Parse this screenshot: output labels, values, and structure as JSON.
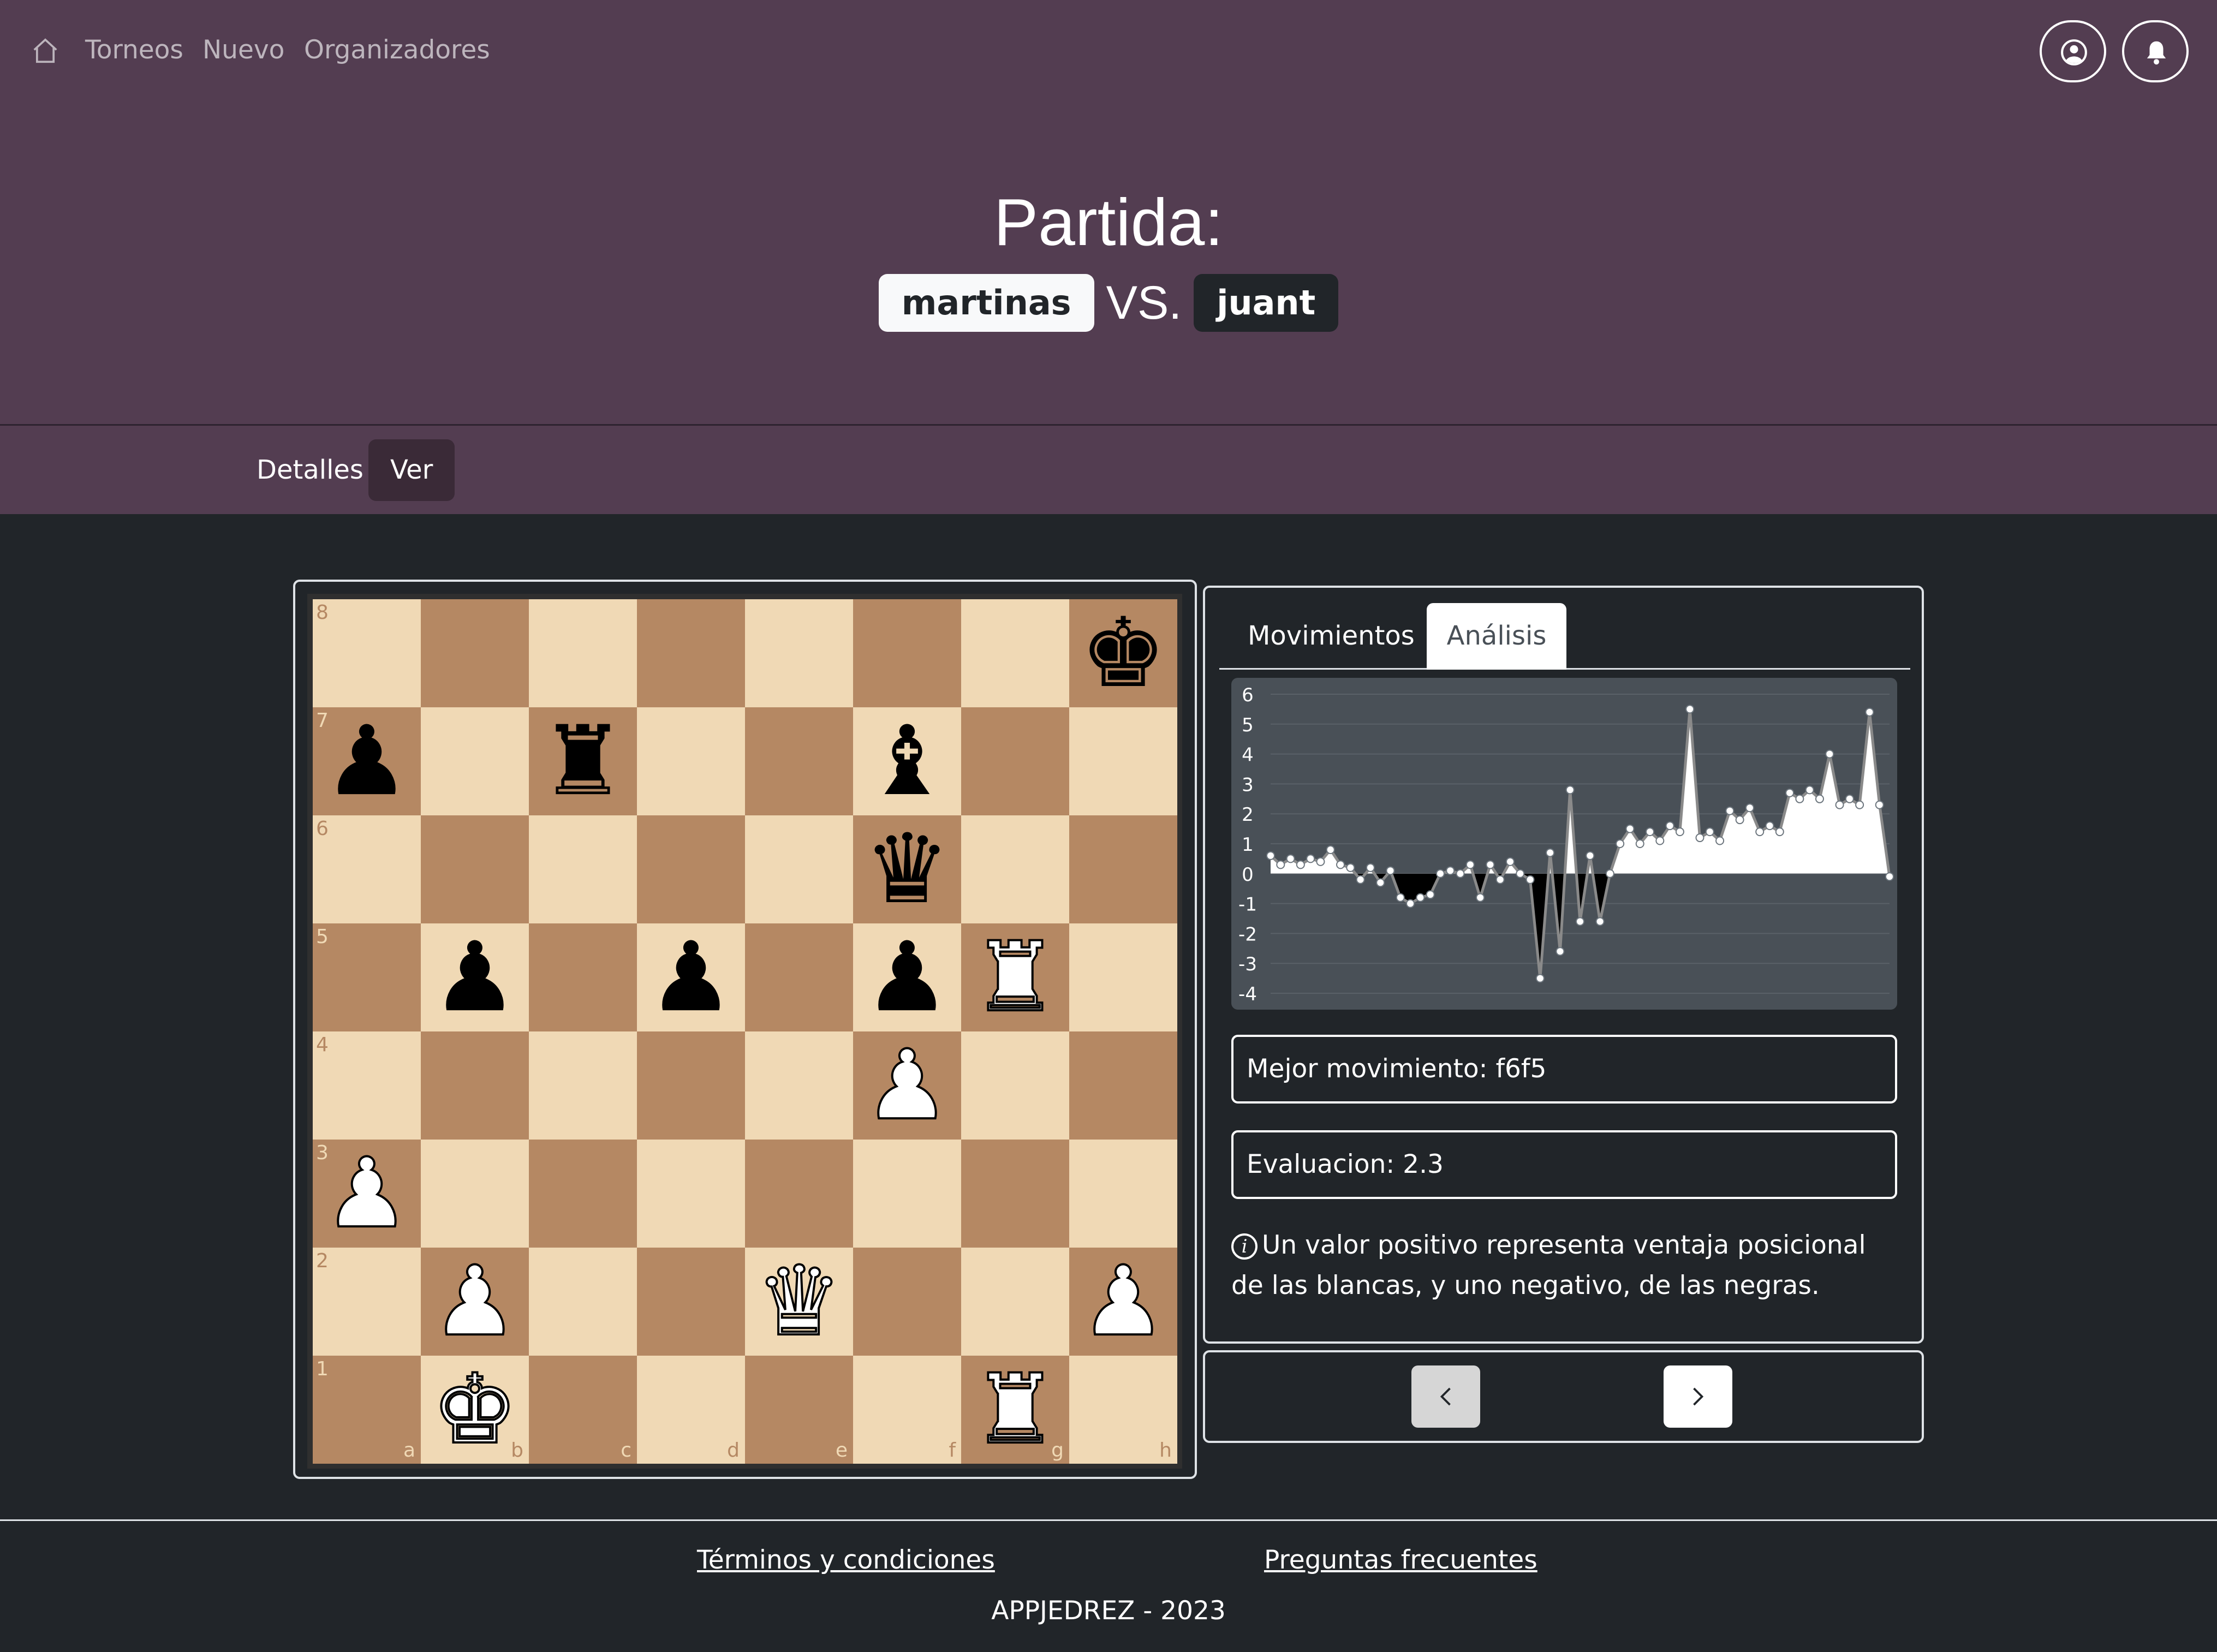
{
  "nav": {
    "links": [
      "Torneos",
      "Nuevo",
      "Organizadores"
    ]
  },
  "header": {
    "title": "Partida:",
    "player_white": "martinas",
    "vs": "VS.",
    "player_black": "juant"
  },
  "page_tabs": {
    "details": "Detalles",
    "view": "Ver",
    "active": "Ver"
  },
  "board": {
    "files": [
      "a",
      "b",
      "c",
      "d",
      "e",
      "f",
      "g",
      "h"
    ],
    "ranks": [
      "8",
      "7",
      "6",
      "5",
      "4",
      "3",
      "2",
      "1"
    ],
    "pieces": [
      {
        "square": "h8",
        "piece": "K",
        "color": "black"
      },
      {
        "square": "a7",
        "piece": "P",
        "color": "black"
      },
      {
        "square": "c7",
        "piece": "R",
        "color": "black"
      },
      {
        "square": "f7",
        "piece": "B",
        "color": "black"
      },
      {
        "square": "f6",
        "piece": "Q",
        "color": "black"
      },
      {
        "square": "b5",
        "piece": "P",
        "color": "black"
      },
      {
        "square": "d5",
        "piece": "P",
        "color": "black"
      },
      {
        "square": "f5",
        "piece": "P",
        "color": "black"
      },
      {
        "square": "g5",
        "piece": "R",
        "color": "white"
      },
      {
        "square": "f4",
        "piece": "P",
        "color": "white"
      },
      {
        "square": "a3",
        "piece": "P",
        "color": "white"
      },
      {
        "square": "b2",
        "piece": "P",
        "color": "white"
      },
      {
        "square": "e2",
        "piece": "Q",
        "color": "white"
      },
      {
        "square": "h2",
        "piece": "P",
        "color": "white"
      },
      {
        "square": "b1",
        "piece": "K",
        "color": "white"
      },
      {
        "square": "g1",
        "piece": "R",
        "color": "white"
      }
    ],
    "colors": {
      "light": "#f0d9b5",
      "dark": "#b58863"
    }
  },
  "panel": {
    "tabs": [
      "Movimientos",
      "Análisis"
    ],
    "active_tab": "Análisis",
    "best_move": "Mejor movimiento: f6f5",
    "evaluation": "Evaluacion: 2.3",
    "note": "Un valor positivo representa ventaja posicional de las blancas, y uno negativo, de las negras.",
    "nav_buttons": [
      "chevron-left-icon",
      "chevron-right-icon"
    ]
  },
  "chart_data": {
    "type": "area",
    "title": "",
    "xlabel": "",
    "ylabel": "",
    "ylim": [
      -4,
      6
    ],
    "yticks": [
      6,
      5,
      4,
      3,
      2,
      1,
      0,
      -1,
      -2,
      -3,
      -4
    ],
    "grid": true,
    "legend": "none",
    "colors": {
      "background": "#495057",
      "positive_fill": "#ffffff",
      "negative_fill": "#000000",
      "line": "#8a8a8a",
      "point": "#ffffff"
    },
    "values": [
      0.6,
      0.3,
      0.5,
      0.3,
      0.5,
      0.4,
      0.8,
      0.3,
      0.2,
      -0.2,
      0.2,
      -0.3,
      0.1,
      -0.8,
      -1.0,
      -0.8,
      -0.7,
      0.0,
      0.1,
      0.0,
      0.3,
      -0.8,
      0.3,
      -0.2,
      0.4,
      0.0,
      -0.2,
      -3.5,
      0.7,
      -2.6,
      2.8,
      -1.6,
      0.6,
      -1.6,
      0.0,
      1.0,
      1.5,
      1.0,
      1.4,
      1.1,
      1.6,
      1.4,
      5.5,
      1.2,
      1.4,
      1.1,
      2.1,
      1.8,
      2.2,
      1.4,
      1.6,
      1.4,
      2.7,
      2.5,
      2.8,
      2.5,
      4.0,
      2.3,
      2.5,
      2.3,
      5.4,
      2.3,
      -0.1
    ]
  },
  "footer": {
    "terms": "Términos y condiciones",
    "faq": "Preguntas frecuentes",
    "copyright": "APPJEDREZ - 2023"
  }
}
